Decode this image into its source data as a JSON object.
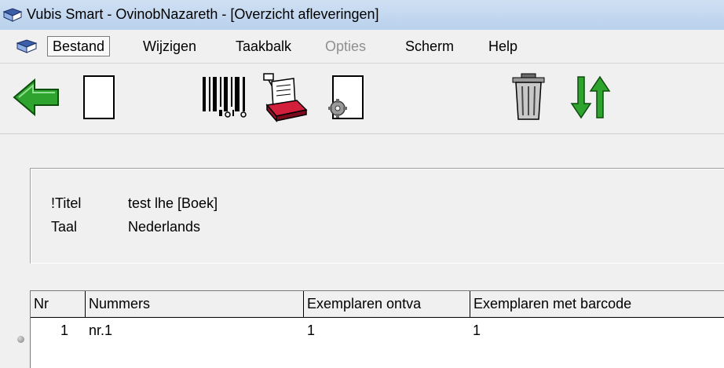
{
  "window": {
    "title": "Vubis Smart - OvinobNazareth - [Overzicht afleveringen]"
  },
  "menu": [
    {
      "label": "Bestand",
      "state": "active"
    },
    {
      "label": "Wijzigen",
      "state": "normal"
    },
    {
      "label": "Taakbalk",
      "state": "normal"
    },
    {
      "label": "Opties",
      "state": "disabled"
    },
    {
      "label": "Scherm",
      "state": "normal"
    },
    {
      "label": "Help",
      "state": "normal"
    }
  ],
  "toolbar": {
    "icons": [
      "back-arrow-icon",
      "new-document-icon",
      "barcode-icon",
      "print-receipt-icon",
      "document-settings-icon",
      "trash-icon",
      "sort-arrows-icon"
    ],
    "colors": {
      "arrow": "#2ea32e",
      "receipt_base": "#d21f3c"
    }
  },
  "info": {
    "title_label": "!Titel",
    "title_value": "test lhe [Boek]",
    "language_label": "Taal",
    "language_value": "Nederlands"
  },
  "table": {
    "columns": [
      "Nr",
      "Nummers",
      "Exemplaren ontva",
      "Exemplaren met barcode"
    ],
    "rows": [
      {
        "nr": "1",
        "nummers": "nr.1",
        "ontvangen": "1",
        "barcode": "1"
      }
    ]
  }
}
